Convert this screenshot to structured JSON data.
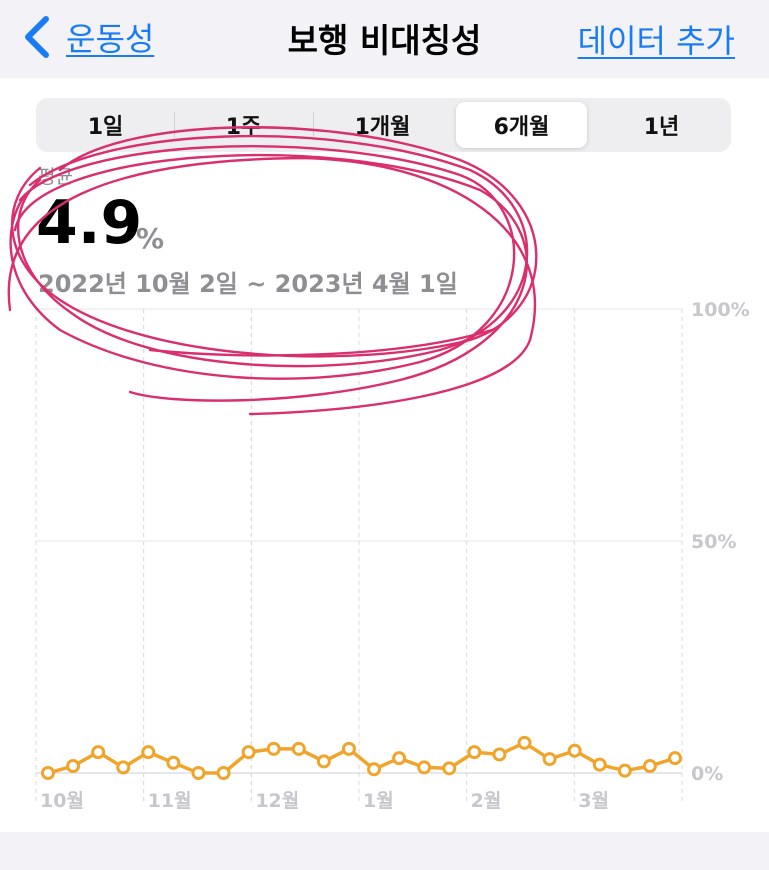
{
  "nav": {
    "back_label": "운동성",
    "title": "보행 비대칭성",
    "add_label": "데이터 추가"
  },
  "segments": [
    {
      "label": "1일",
      "selected": false
    },
    {
      "label": "1주",
      "selected": false
    },
    {
      "label": "1개월",
      "selected": false
    },
    {
      "label": "6개월",
      "selected": true
    },
    {
      "label": "1년",
      "selected": false
    }
  ],
  "summary": {
    "label": "평균",
    "value": "4.9",
    "unit": "%",
    "date_range": "2022년 10월 2일 ~ 2023년 4월 1일"
  },
  "colors": {
    "accent": "#1a7cf5",
    "series": "#f0a52a",
    "annotation": "#d92f6e"
  },
  "chart_data": {
    "type": "line",
    "y_ticks": [
      "100%",
      "50%",
      "0%"
    ],
    "ylim": [
      0,
      100
    ],
    "x_labels": [
      "10월",
      "11월",
      "12월",
      "1월",
      "2월",
      "3월"
    ],
    "grid": true,
    "series": [
      {
        "values": [
          0,
          1.5,
          4.5,
          1.2,
          4.5,
          2.2,
          0,
          0,
          4.5,
          5.2,
          5.2,
          2.5,
          5.2,
          0.8,
          3.2,
          1.2,
          1,
          4.5,
          4,
          6.5,
          3,
          4.8,
          1.8,
          0.5,
          1.5,
          3.2
        ]
      }
    ]
  }
}
